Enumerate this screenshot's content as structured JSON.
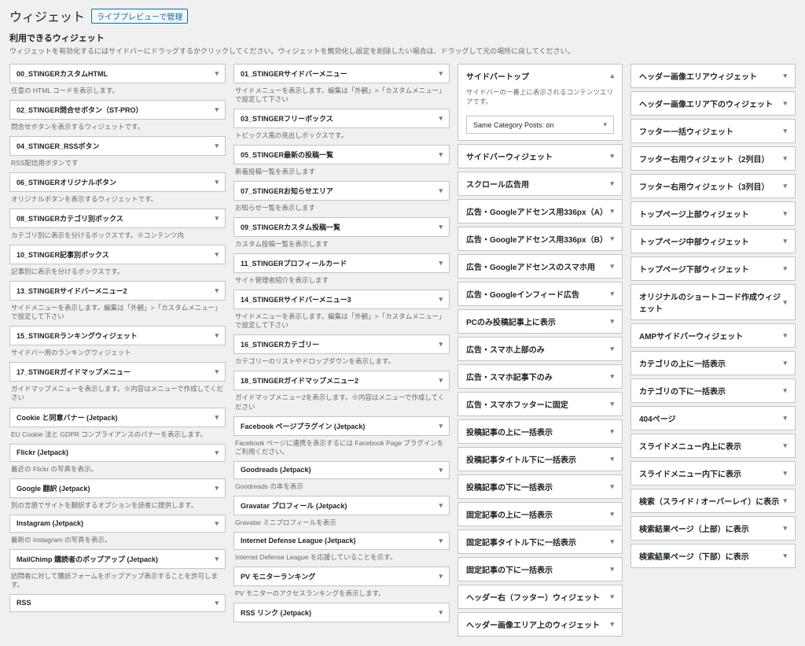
{
  "page": {
    "title": "ウィジェット",
    "live_preview": "ライブプレビューで管理",
    "section_title": "利用できるウィジェット",
    "section_desc": "ウィジェットを有効化するにはサイドバーにドラッグするかクリックしてください。ウィジェットを無効化し設定を削除したい場合は、ドラッグして元の場所に戻してください。"
  },
  "avail_left": [
    {
      "t": "00_STINGERカスタムHTML",
      "d": "任意の HTML コードを表示します。"
    },
    {
      "t": "02_STINGER問合せボタン（ST-PRO）",
      "d": "問合せボタンを表示するウィジェットです。"
    },
    {
      "t": "04_STINGER_RSSボタン",
      "d": "RSS配信用ボタンです"
    },
    {
      "t": "06_STINGERオリジナルボタン",
      "d": "オリジナルボタンを表示するウィジェットです。"
    },
    {
      "t": "08_STINGERカテゴリ別ボックス",
      "d": "カテゴリ別に表示を分けるボックスです。※コンテンツ内"
    },
    {
      "t": "10_STINGER記事別ボックス",
      "d": "記事別に表示を分けるボックスです。"
    },
    {
      "t": "13_STINGERサイドバーメニュー2",
      "d": "サイドメニューを表示します。編集は「外観」>「カスタムメニュー」で設定して下さい"
    },
    {
      "t": "15_STINGERランキングウィジェット",
      "d": "サイドバー用のランキングウィジェット"
    },
    {
      "t": "17_STINGERガイドマップメニュー",
      "d": "ガイドマップメニューを表示します。※内容はメニューで作成してください"
    },
    {
      "t": "Cookie と同意バナー (Jetpack)",
      "d": "EU Cookie 法と GDPR コンプライアンスのバナーを表示します。"
    },
    {
      "t": "Flickr (Jetpack)",
      "d": "最近の Flickr の写真を表示。"
    },
    {
      "t": "Google 翻訳 (Jetpack)",
      "d": "別の言語でサイトを翻訳するオプションを読者に提供します。"
    },
    {
      "t": "Instagram (Jetpack)",
      "d": "最新の Instagram の写真を表示。"
    },
    {
      "t": "MailChimp 購読者のポップアップ (Jetpack)",
      "d": "訪問者に対して購読フォームをポップアップ表示することを許可します。"
    },
    {
      "t": "RSS",
      "d": ""
    }
  ],
  "avail_right": [
    {
      "t": "01_STINGERサイドバーメニュー",
      "d": "サイドメニューを表示します。編集は「外観」>「カスタムメニュー」で設定して下さい"
    },
    {
      "t": "03_STINGERフリーボックス",
      "d": "トピックス風の見出しボックスです。"
    },
    {
      "t": "05_STINGER最新の投稿一覧",
      "d": "新着投稿一覧を表示します"
    },
    {
      "t": "07_STINGERお知らせエリア",
      "d": "お知らせ一覧を表示します"
    },
    {
      "t": "09_STINGERカスタム投稿一覧",
      "d": "カスタム投稿一覧を表示します"
    },
    {
      "t": "11_STINGERプロフィールカード",
      "d": "サイト管理者紹介を表示します"
    },
    {
      "t": "14_STINGERサイドバーメニュー3",
      "d": "サイドメニューを表示します。編集は「外観」>「カスタムメニュー」で設定して下さい"
    },
    {
      "t": "16_STINGERカテゴリー",
      "d": "カテゴリーのリストやドロップダウンを表示します。"
    },
    {
      "t": "18_STINGERガイドマップメニュー2",
      "d": "ガイドマップメニュー2を表示します。※内容はメニューで作成してください"
    },
    {
      "t": "Facebook ページプラグイン (Jetpack)",
      "d": "Facebook ページに連携を表示するには Facebook Page プラグインをご利用ください。"
    },
    {
      "t": "Goodreads (Jetpack)",
      "d": "Goodreads の本を表示"
    },
    {
      "t": "Gravatar プロフィール (Jetpack)",
      "d": "Gravatar ミニプロフィールを表示"
    },
    {
      "t": "Internet Defense League (Jetpack)",
      "d": "Internet Defense League を応援していることを示す。"
    },
    {
      "t": "PV モニターランキング",
      "d": "PV モニターのアクセスランキングを表示します。"
    },
    {
      "t": "RSS リンク (Jetpack)",
      "d": ""
    }
  ],
  "areas_a": {
    "open": {
      "title": "サイドバートップ",
      "desc": "サイドバーの一番上に表示されるコンテンツエリアです。",
      "chooser": "Same Category Posts: on"
    },
    "list": [
      "サイドバーウィジェット",
      "スクロール広告用",
      "広告・Googleアドセンス用336px（A）",
      "広告・Googleアドセンス用336px（B）",
      "広告・Googleアドセンスのスマホ用",
      "広告・Googleインフィード広告",
      "PCのみ投稿記事上に表示",
      "広告・スマホ上部のみ",
      "広告・スマホ記事下のみ",
      "広告・スマホフッターに固定",
      "投稿記事の上に一括表示",
      "投稿記事タイトル下に一括表示",
      "投稿記事の下に一括表示",
      "固定記事の上に一括表示",
      "固定記事タイトル下に一括表示",
      "固定記事の下に一括表示",
      "ヘッダー右（フッター）ウィジェット",
      "ヘッダー画像エリア上のウィジェット"
    ]
  },
  "areas_b": [
    "ヘッダー画像エリアウィジェット",
    "ヘッダー画像エリア下のウィジェット",
    "フッター一括ウィジェット",
    "フッター右用ウィジェット（2列目）",
    "フッター右用ウィジェット（3列目）",
    "トップページ上部ウィジェット",
    "トップページ中部ウィジェット",
    "トップページ下部ウィジェット",
    "オリジナルのショートコード作成ウィジェット",
    "AMPサイドバーウィジェット",
    "カテゴリの上に一括表示",
    "カテゴリの下に一括表示",
    "404ページ",
    "スライドメニュー内上に表示",
    "スライドメニュー内下に表示",
    "検索（スライド / オーバーレイ）に表示",
    "検索結果ページ（上部）に表示",
    "検索結果ページ（下部）に表示"
  ]
}
